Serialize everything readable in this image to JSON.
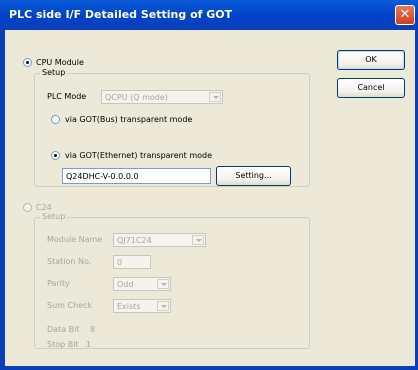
{
  "dialog": {
    "title": "PLC side I/F Detailed Setting of GOT",
    "close_glyph": "✕"
  },
  "buttons": {
    "ok": "OK",
    "cancel": "Cancel",
    "setting": "Setting..."
  },
  "cpu_module": {
    "label": "CPU Module",
    "selected": true,
    "setup": {
      "title": "Setup",
      "plc_mode_label": "PLC Mode",
      "plc_mode_value": "QCPU (Q mode)",
      "via_bus_label": "via GOT(Bus) transparent mode",
      "via_ethernet_label": "via GOT(Ethernet) transparent mode",
      "ethernet_selected": true,
      "ethernet_value": "Q24DHC-V-0.0.0.0"
    }
  },
  "c24": {
    "label": "C24",
    "selected": false,
    "setup": {
      "title": "Setup",
      "module_name_label": "Module Name",
      "module_name_value": "QJ71C24",
      "station_no_label": "Station No.",
      "station_no_value": "0",
      "parity_label": "Parity",
      "parity_value": "Odd",
      "sum_check_label": "Sum Check",
      "sum_check_value": "Exists",
      "data_bit_label": "Data Bit",
      "data_bit_value": "8",
      "stop_bit_label": "Stop Bit",
      "stop_bit_value": "1"
    }
  },
  "colors": {
    "titlebar": "#0A5BD8",
    "dialog_bg": "#ECE9D8",
    "close_button": "#C9401C",
    "disabled_text": "#A7A69A"
  }
}
